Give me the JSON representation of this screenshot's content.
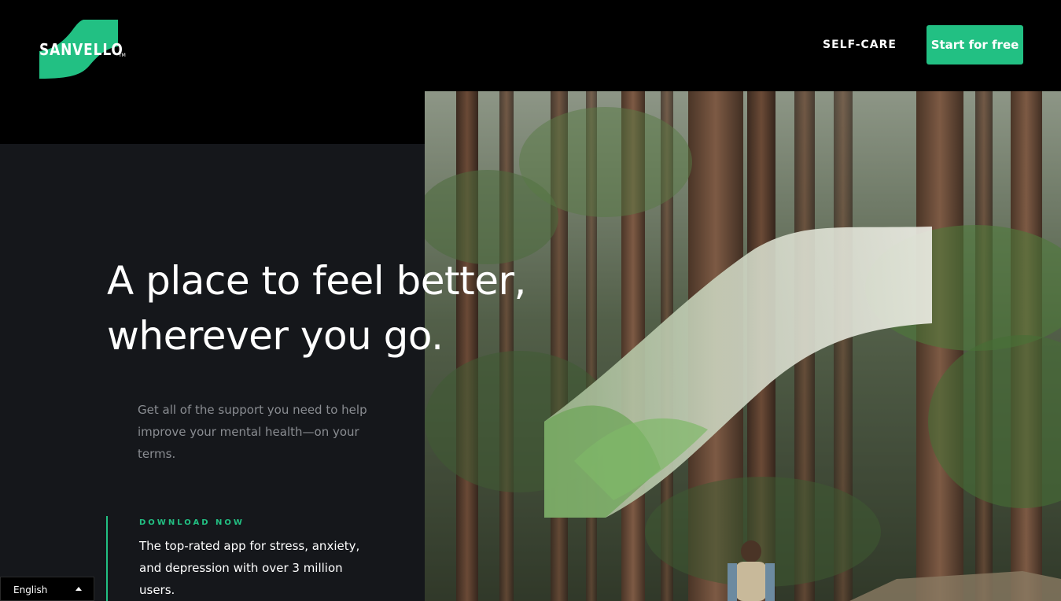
{
  "header": {
    "logo_text": "SANVELLO",
    "logo_tm": "TM",
    "nav_selfcare": "SELF-CARE",
    "cta_label": "Start for free"
  },
  "hero": {
    "headline_line1": "A place to feel better,",
    "headline_line2": "wherever you go.",
    "subtext": "Get all of the support you need to help improve your mental health—on your terms."
  },
  "download": {
    "label": "DOWNLOAD NOW",
    "text": "The top-rated app for stress, anxiety, and depression with over 3 million users."
  },
  "language": {
    "selected": "English"
  },
  "colors": {
    "accent": "#22c083",
    "dark_panel": "#15171b",
    "background": "#000000"
  },
  "icons": {
    "logo": "sanvello-s-logo-icon",
    "language_caret": "caret-up-icon"
  }
}
